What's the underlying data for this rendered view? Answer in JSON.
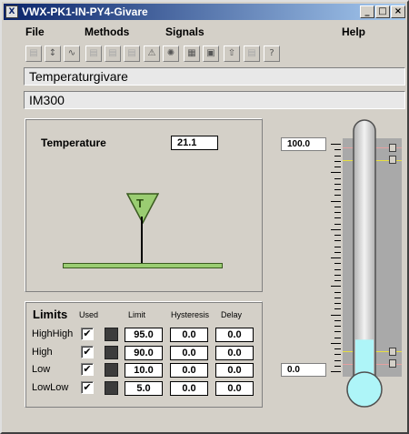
{
  "window": {
    "title": "VWX-PK1-IN-PY4-Givare",
    "icon": "app-icon",
    "controls": [
      "minimize-icon",
      "maximize-icon",
      "close-icon"
    ]
  },
  "menu": {
    "file": "File",
    "methods": "Methods",
    "signals": "Signals",
    "help": "Help"
  },
  "toolbar": {
    "icons": [
      "graph-icon",
      "trend-icon",
      "chart-icon",
      "list-icon",
      "table-icon",
      "doc-icon",
      "alarm-icon",
      "block-icon",
      "hierarchy-icon",
      "window-icon",
      "export-icon",
      "note-icon",
      "help-icon"
    ]
  },
  "fields": {
    "description": "Temperaturgivare",
    "object": "IM300"
  },
  "sensor": {
    "label": "Temperature",
    "value": "21.1",
    "symbol": "T"
  },
  "limits": {
    "title": "Limits",
    "headers": {
      "used": "Used",
      "limit": "Limit",
      "hysteresis": "Hysteresis",
      "delay": "Delay"
    },
    "rows": [
      {
        "name": "HighHigh",
        "used": "✔",
        "limit": "95.0",
        "hysteresis": "0.0",
        "delay": "0.0"
      },
      {
        "name": "High",
        "used": "✔",
        "limit": "90.0",
        "hysteresis": "0.0",
        "delay": "0.0"
      },
      {
        "name": "Low",
        "used": "✔",
        "limit": "10.0",
        "hysteresis": "0.0",
        "delay": "0.0"
      },
      {
        "name": "LowLow",
        "used": "✔",
        "limit": "5.0",
        "hysteresis": "0.0",
        "delay": "0.0"
      }
    ]
  },
  "thermometer": {
    "max_label": "100.0",
    "min_label": "0.0",
    "level": 0.21,
    "fill_color": "#aef5f8"
  }
}
